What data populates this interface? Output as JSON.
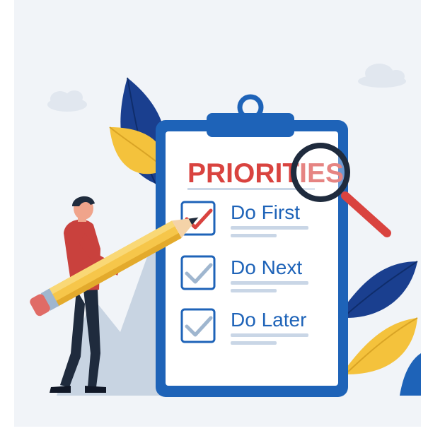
{
  "clipboard": {
    "title": "PRIORITIES",
    "items": [
      {
        "label": "Do First",
        "checked": true,
        "check_color": "#d9433f"
      },
      {
        "label": "Do Next",
        "checked": true,
        "check_color": "#9fb6cf"
      },
      {
        "label": "Do Later",
        "checked": true,
        "check_color": "#9fb6cf"
      }
    ]
  },
  "colors": {
    "background": "#f1f4f8",
    "clipboard_blue": "#1e63b8",
    "title_red": "#d9433f",
    "pencil_yellow": "#f6c64a",
    "leaf_navy": "#1a3f8f",
    "leaf_yellow": "#f4c23c"
  }
}
